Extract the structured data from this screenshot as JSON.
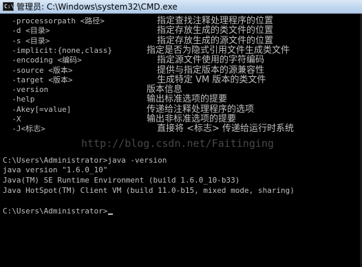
{
  "window": {
    "title": "管理员: C:\\Windows\\system32\\CMD.exe",
    "app_icon": "C:\\"
  },
  "options": [
    {
      "flag": "  -processorpath <路径>",
      "desc": "指定查找注释处理程序的位置"
    },
    {
      "flag": "  -d <目录>",
      "desc": "指定存放生成的类文件的位置"
    },
    {
      "flag": "  -s <目录>",
      "desc": "指定存放生成的源文件的位置"
    },
    {
      "flag": "  -implicit:{none,class}",
      "desc": "指定是否为隐式引用文件生成类文件"
    },
    {
      "flag": "  -encoding <编码>",
      "desc": "指定源文件使用的字符编码"
    },
    {
      "flag": "  -source <版本>",
      "desc": "提供与指定版本的源兼容性"
    },
    {
      "flag": "  -target <版本>",
      "desc": "生成特定 VM 版本的类文件"
    },
    {
      "flag": "  -version",
      "desc": "版本信息"
    },
    {
      "flag": "  -help",
      "desc": "输出标准选项的提要"
    },
    {
      "flag": "  -Akey[=value]",
      "desc": "传递给注释处理程序的选项"
    },
    {
      "flag": "  -X",
      "desc": "输出非标准选项的提要"
    },
    {
      "flag": "  -J<标志>",
      "desc": "直接将 <标志> 传递给运行时系统"
    }
  ],
  "session": [
    "C:\\Users\\Administrator>java -version",
    "java version \"1.6.0_10\"",
    "Java(TM) SE Runtime Environment (build 1.6.0_10-b33)",
    "Java HotSpot(TM) Client VM (build 11.0-b15, mixed mode, sharing)",
    "",
    "C:\\Users\\Administrator>"
  ],
  "watermark": "http://blog.csdn.net/Faitinging"
}
